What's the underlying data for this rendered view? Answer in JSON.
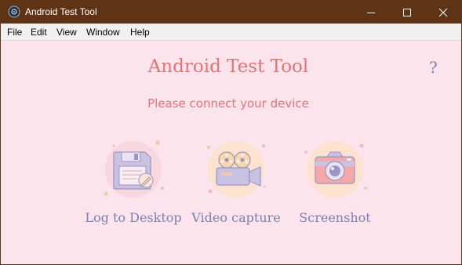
{
  "window": {
    "title": "Android Test Tool",
    "controls": [
      "minimize",
      "maximize",
      "close"
    ]
  },
  "menu": {
    "items": [
      "File",
      "Edit",
      "View",
      "Window",
      "Help"
    ]
  },
  "main": {
    "heading": "Android Test Tool",
    "help_label": "?",
    "status": "Please connect your device",
    "actions": [
      {
        "label": "Log to Desktop",
        "icon": "floppy-disk-icon"
      },
      {
        "label": "Video capture",
        "icon": "video-camera-icon"
      },
      {
        "label": "Screenshot",
        "icon": "photo-camera-icon"
      }
    ]
  },
  "colors": {
    "titlebar": "#5f3415",
    "background": "#fce4ec",
    "heading": "#e57373",
    "accent": "#7b7fb3"
  }
}
